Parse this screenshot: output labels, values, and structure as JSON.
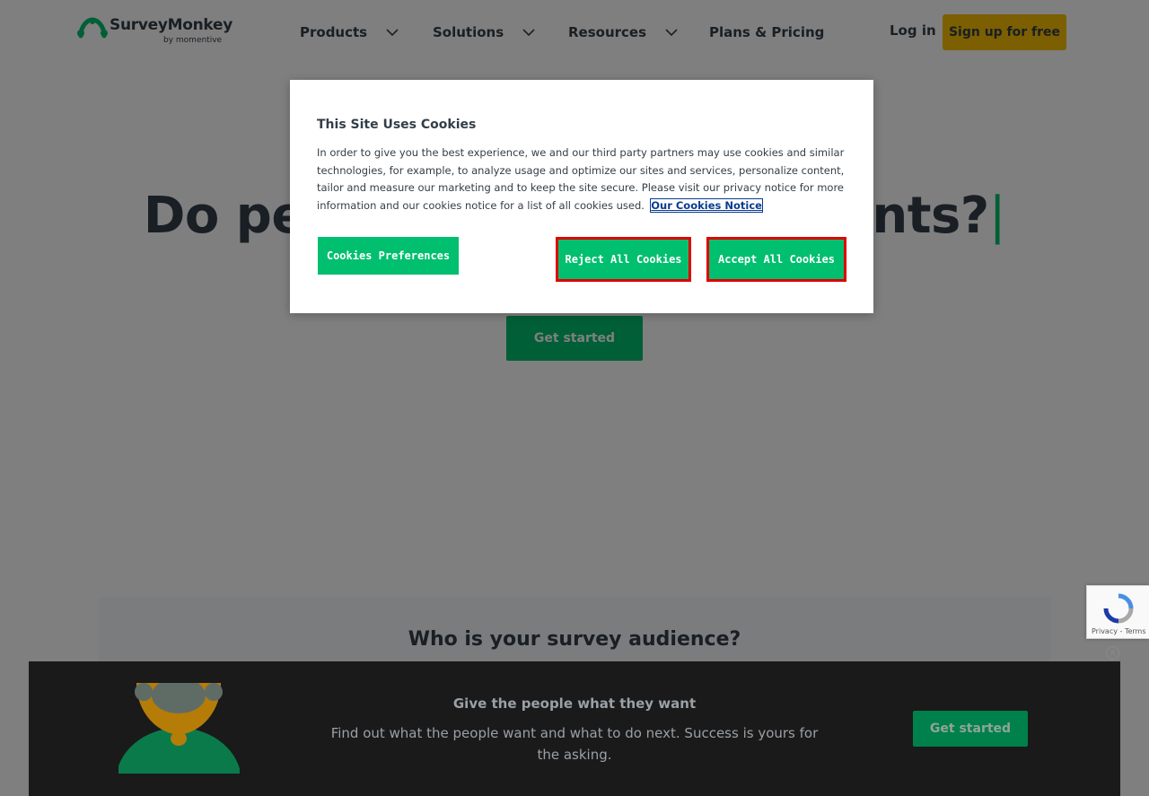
{
  "nav": {
    "logo_text": "SurveyMonkey",
    "logo_sub": "by momentive",
    "items": [
      {
        "label": "Products",
        "has_dropdown": true
      },
      {
        "label": "Solutions",
        "has_dropdown": true
      },
      {
        "label": "Resources",
        "has_dropdown": true
      },
      {
        "label": "Plans & Pricing",
        "has_dropdown": false
      }
    ],
    "login_label": "Log in",
    "signup_label": "Sign up for free"
  },
  "hero": {
    "title_visible": "Do peo",
    "title_end": "ents?",
    "cursor": "|",
    "cta_label": "Get started"
  },
  "audience": {
    "title": "Who is your survey audience?"
  },
  "cookie_modal": {
    "title": "This Site Uses Cookies",
    "body": "In order to give you the best experience, we and our third party partners may use cookies and similar technologies, for example, to analyze usage and optimize our sites and services, personalize content, tailor and measure our marketing and to keep the site secure. Please visit our privacy notice for more information and our cookies notice for a list of all cookies used.",
    "link_label": "Our Cookies Notice",
    "preferences_label": "Cookies Preferences",
    "reject_label": "Reject All Cookies",
    "accept_label": "Accept All Cookies"
  },
  "recaptcha": {
    "terms": "Privacy - Terms"
  },
  "promo": {
    "title": "Give the people what they want",
    "text": "Find out what the people want and what to do next. Success is yours for the asking.",
    "cta_label": "Get started"
  },
  "colors": {
    "brand_green": "#00bf6f",
    "signup_yellow": "#f9be00",
    "highlight_red": "#e00000",
    "text_dark": "#333e48"
  }
}
